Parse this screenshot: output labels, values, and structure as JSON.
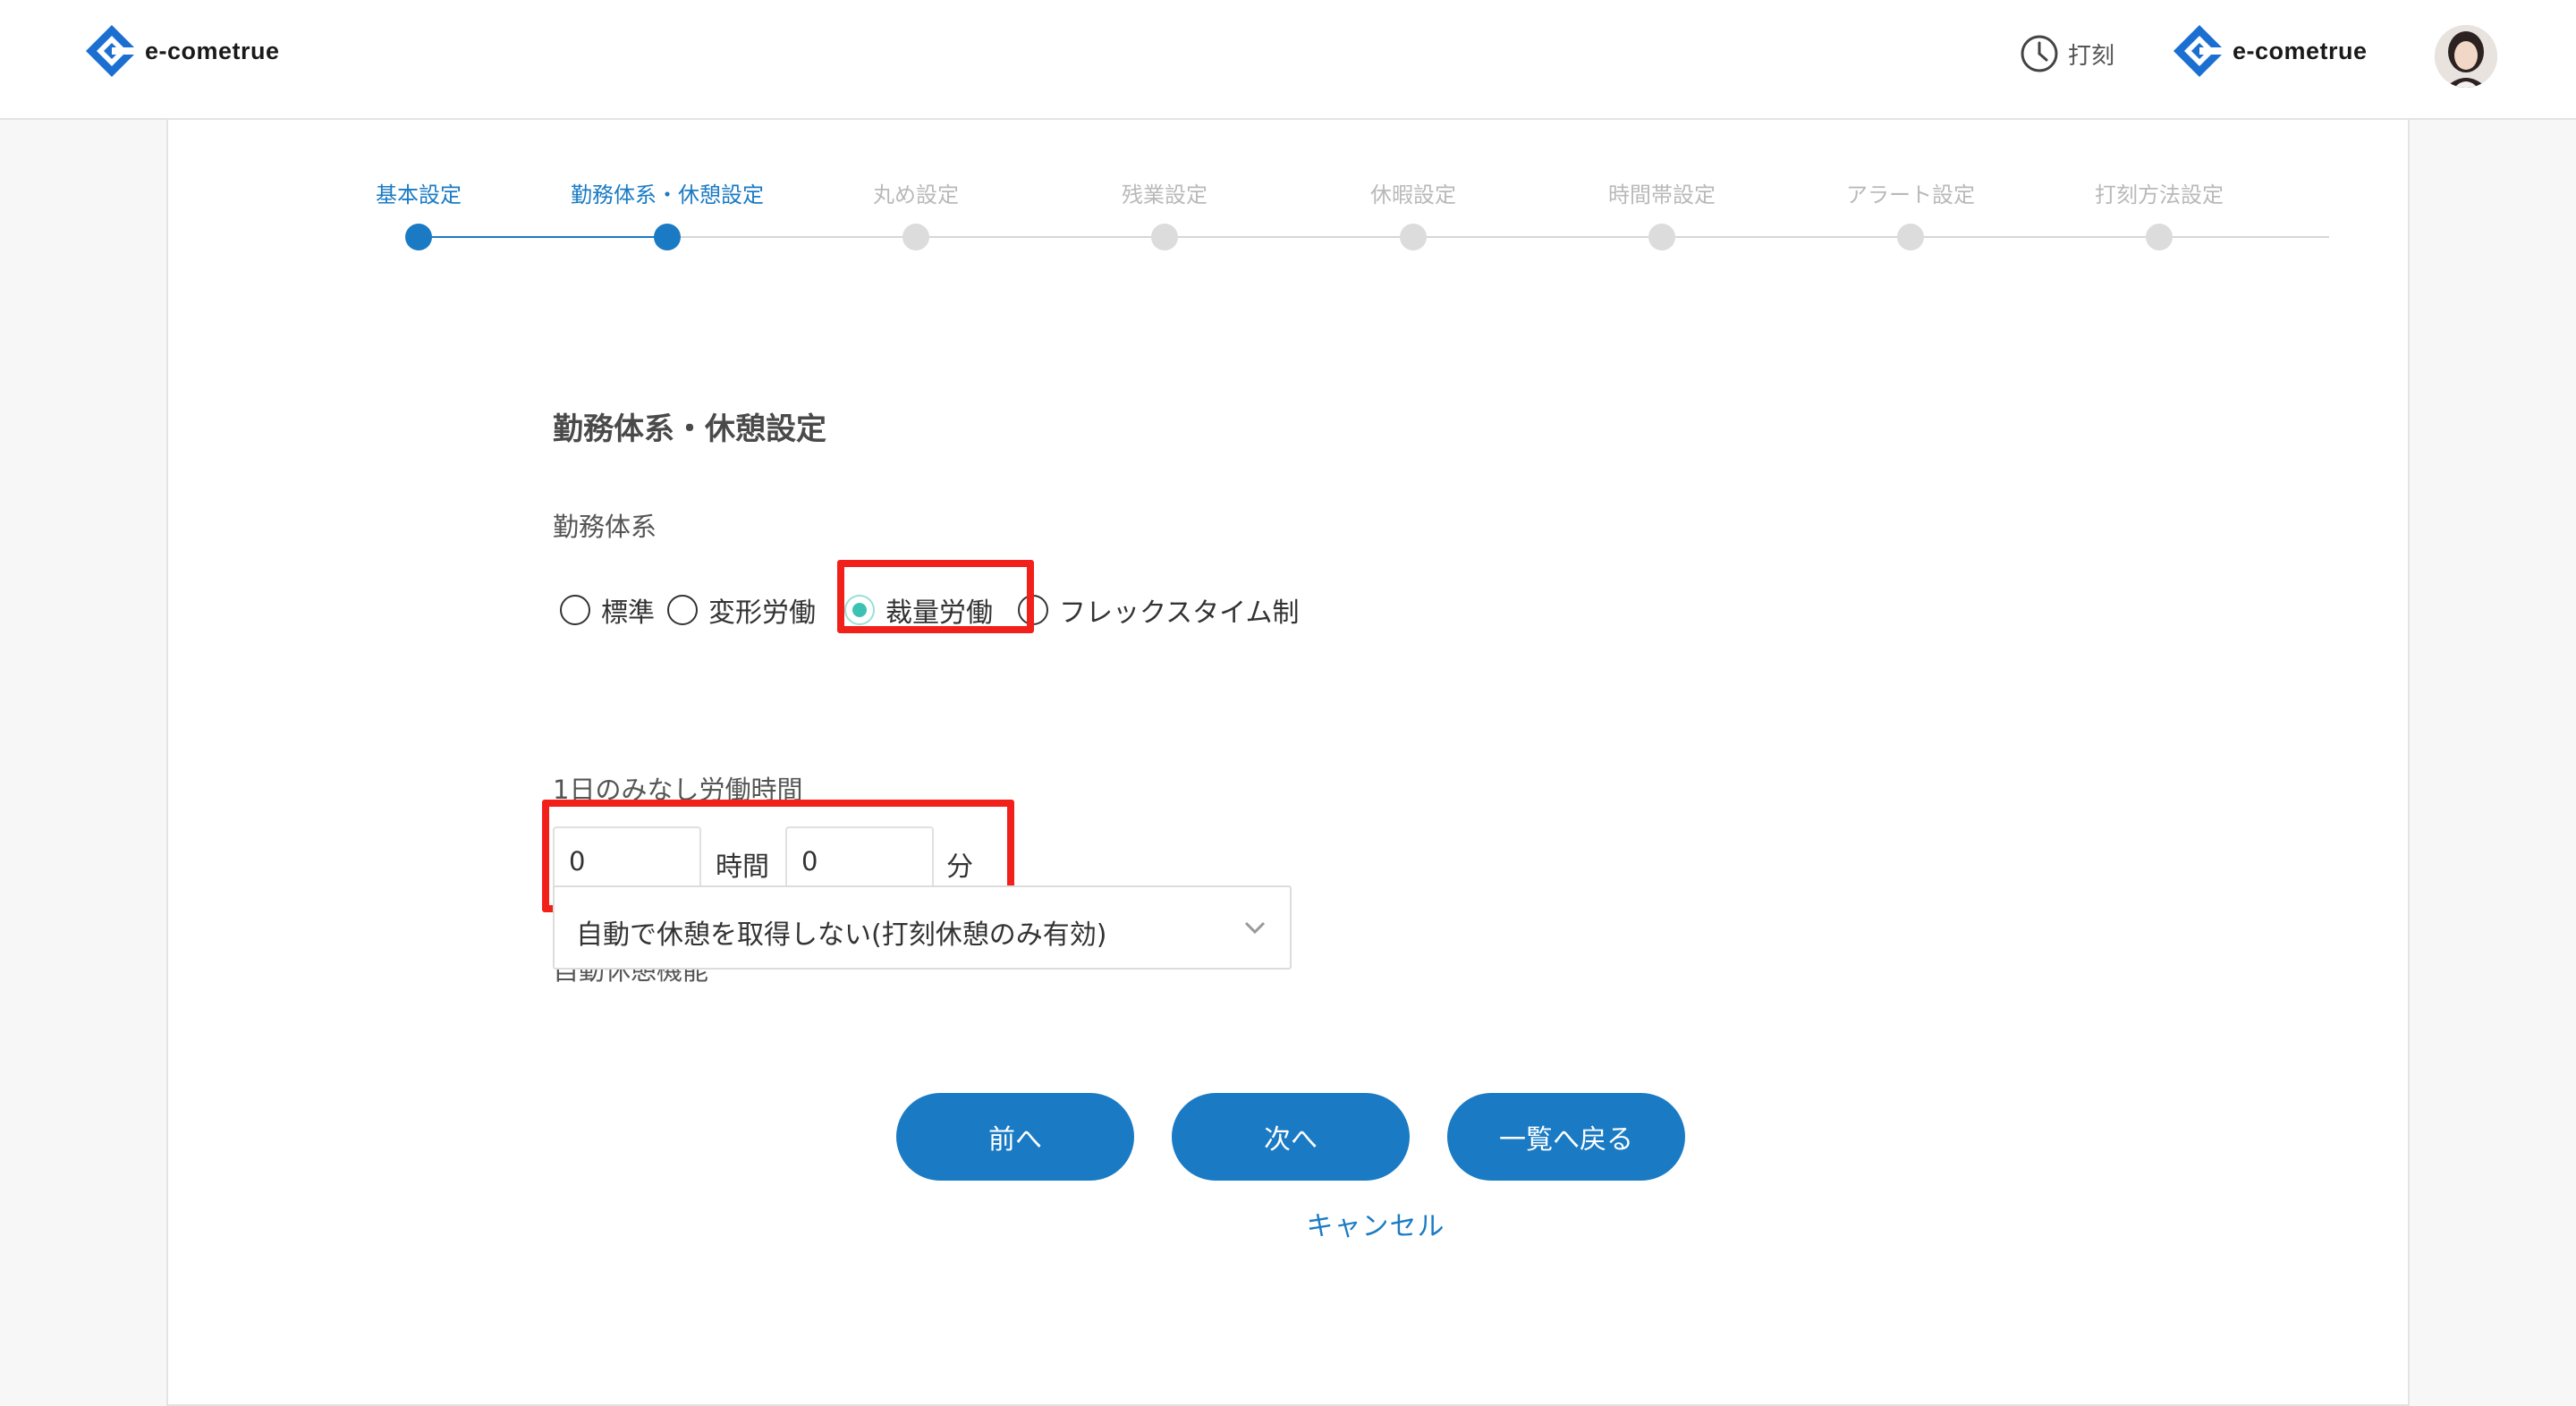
{
  "header": {
    "brand": "e-cometrue",
    "punch_label": "打刻",
    "brand_color": "#1a6fd0"
  },
  "stepper": {
    "steps": [
      {
        "label": "基本設定",
        "state": "done"
      },
      {
        "label": "勤務体系・休憩設定",
        "state": "current"
      },
      {
        "label": "丸め設定",
        "state": "todo"
      },
      {
        "label": "残業設定",
        "state": "todo"
      },
      {
        "label": "休暇設定",
        "state": "todo"
      },
      {
        "label": "時間帯設定",
        "state": "todo"
      },
      {
        "label": "アラート設定",
        "state": "todo"
      },
      {
        "label": "打刻方法設定",
        "state": "todo"
      }
    ],
    "accent": "#1a7bc4"
  },
  "form": {
    "title": "勤務体系・休憩設定",
    "work_system_label": "勤務体系",
    "work_system_options": [
      "標準",
      "変形労働",
      "裁量労働",
      "フレックスタイム制"
    ],
    "work_system_selected": "裁量労働",
    "deemed_hours_label": "1日のみなし労働時間",
    "deemed_hours_value": "0",
    "hours_unit": "時間",
    "deemed_minutes_value": "0",
    "minutes_unit": "分",
    "auto_break_label": "自動休憩機能",
    "auto_break_selected": "自動で休憩を取得しない(打刻休憩のみ有効)",
    "highlight_color": "#f2201b"
  },
  "actions": {
    "prev_label": "前へ",
    "next_label": "次へ",
    "back_label": "一覧へ戻る",
    "cancel_label": "キャンセル"
  }
}
